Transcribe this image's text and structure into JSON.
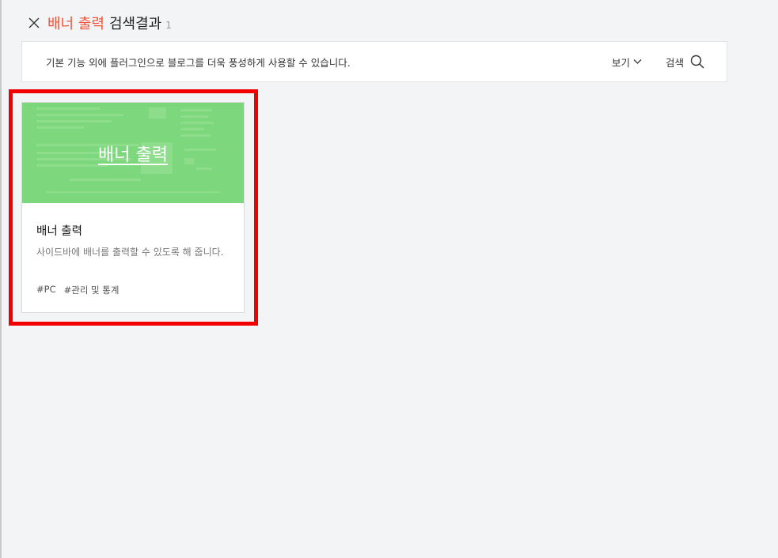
{
  "header": {
    "query": "배너 출력",
    "label": "검색결과",
    "count": "1"
  },
  "toolbar": {
    "description": "기본 기능 외에 플러그인으로 블로그를 더욱 풍성하게 사용할 수 있습니다.",
    "view_label": "보기",
    "search_label": "검색"
  },
  "card": {
    "thumbnail_title": "배너 출력",
    "title": "배너 출력",
    "description": "사이드바에 배너를 출력할 수 있도록 해 줍니다.",
    "tags": [
      "#PC",
      "#관리 및 통계"
    ]
  },
  "colors": {
    "accent": "#f25136",
    "highlight": "#f20000",
    "thumbnail": "#7dd77d"
  }
}
